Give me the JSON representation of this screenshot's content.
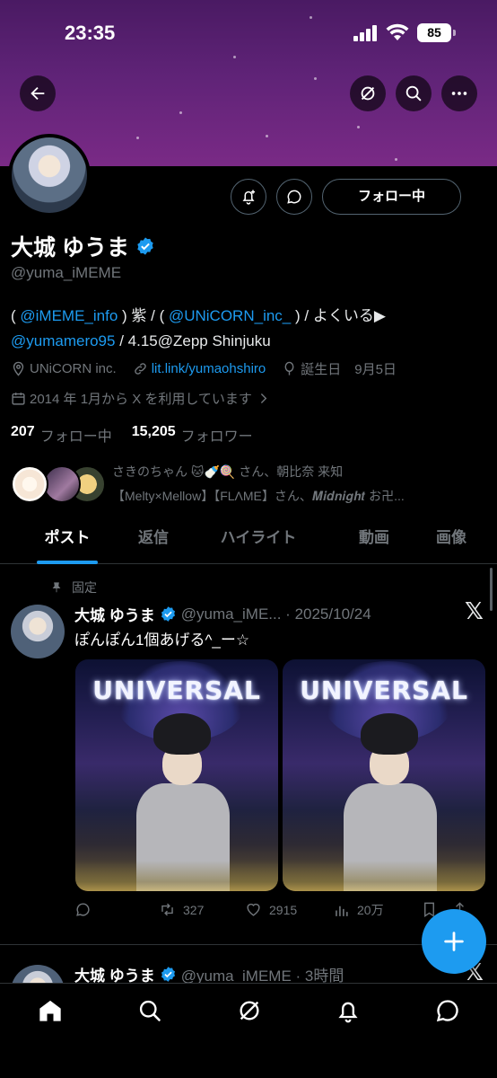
{
  "status_bar": {
    "time": "23:35",
    "battery": "85"
  },
  "header": {
    "back_icon": "arrow-left-icon",
    "grok_icon": "grok-icon",
    "search_icon": "search-icon",
    "more_icon": "more-icon",
    "banner_color": "#5f2377"
  },
  "profile": {
    "display_name": "大城 ゆうま",
    "handle": "@yuma_iMEME",
    "follow_button": "フォロー中",
    "bio": {
      "p1": "( ",
      "link1": "@iMEME_info",
      "p2": " ) 紫 / ( ",
      "link2": "@UNiCORN_inc_",
      "p3": " ) / よくいる▶",
      "link3": "@yumamero95",
      "p4": " / 4.15@Zepp Shinjuku"
    },
    "company": "UNiCORN inc.",
    "website": "lit.link/yumaohshiro",
    "birthday": "誕生日　9月5日",
    "joined": "2014 年 1月から X を利用しています",
    "following_count": "207",
    "following_label": "フォロー中",
    "followers_count": "15,205",
    "followers_label": "フォロワー",
    "known_followers_line1": "さきのちゃん 🐱🍼🍭 さん、朝比奈 来知",
    "known_followers_line2": "【Melty×Mellow】【FLΛME】さん、𝑴𝒊𝒅𝒏𝒊𝒈𝒉𝒕 お卍..."
  },
  "tabs": [
    "ポスト",
    "返信",
    "ハイライト",
    "動画",
    "画像"
  ],
  "posts": [
    {
      "pinned_label": "固定",
      "name": "大城 ゆうま",
      "meta": "@yuma_iME... · 2025/10/24",
      "text": "ぽんぽん1個あげる^_ー☆",
      "photo_sign": "UNIVERSAL",
      "photo_sign_2": "UNIVERSAL",
      "retweets": "327",
      "likes": "2915",
      "views": "20万"
    },
    {
      "name": "大城 ゆうま",
      "meta": "@yuma_iMEME · 3時間"
    }
  ],
  "accent": "#1d9bf0"
}
